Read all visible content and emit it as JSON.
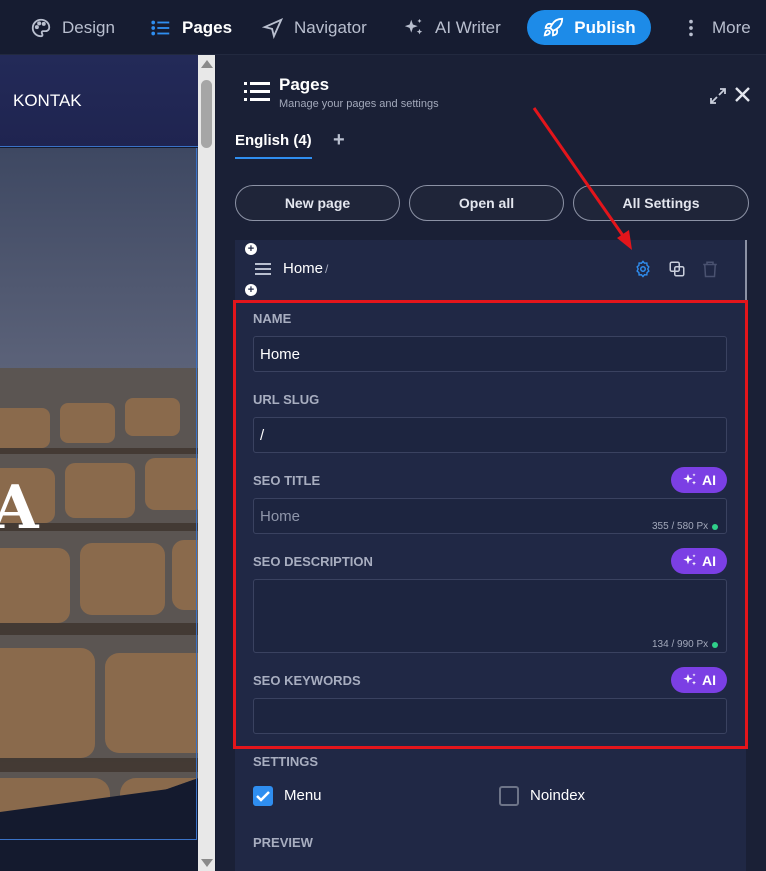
{
  "toolbar": {
    "design": "Design",
    "pages": "Pages",
    "navigator": "Navigator",
    "ai_writer": "AI Writer",
    "publish": "Publish",
    "more": "More"
  },
  "canvas": {
    "nav_item": "KONTAK",
    "hero_letter": "A"
  },
  "panel": {
    "title": "Pages",
    "subtitle": "Manage your pages and settings",
    "lang_tab": "English (4)",
    "add_lang": "+",
    "buttons": {
      "new_page": "New page",
      "open_all": "Open all",
      "all_settings": "All Settings"
    },
    "page": {
      "name": "Home",
      "slug": "/"
    },
    "form": {
      "name_label": "NAME",
      "name_value": "Home",
      "url_label": "URL SLUG",
      "url_value": "/",
      "seo_title_label": "SEO TITLE",
      "seo_title_placeholder": "Home",
      "seo_title_counter": "355 / 580 Px",
      "seo_desc_label": "SEO DESCRIPTION",
      "seo_desc_counter": "134 / 990 Px",
      "seo_keywords_label": "SEO KEYWORDS",
      "ai_label": "AI"
    },
    "settings": {
      "label": "SETTINGS",
      "menu": "Menu",
      "menu_checked": true,
      "noindex": "Noindex",
      "noindex_checked": false
    },
    "preview_label": "PREVIEW"
  },
  "colors": {
    "accent": "#2f8ef0",
    "publish": "#1d8be8",
    "ai": "#7b3fe4",
    "highlight": "#e3151b",
    "counter_ok": "#2fd08a"
  }
}
